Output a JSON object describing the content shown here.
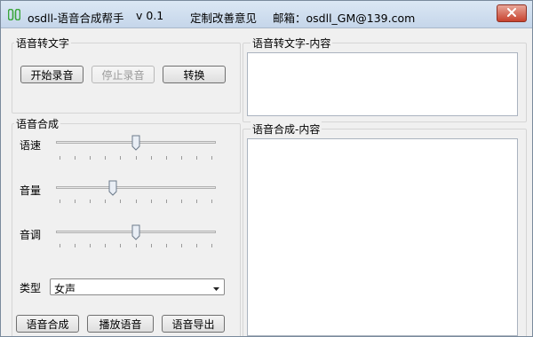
{
  "window": {
    "app_name": "osdll-语音合成帮手",
    "version": "v 0.1",
    "custom_link": "定制改善意见",
    "email": "邮箱：osdll_GM@139.com"
  },
  "stt": {
    "group_label": "语音转文字",
    "start_label": "开始录音",
    "stop_label": "停止录音",
    "convert_label": "转换",
    "content_label": "语音转文字-内容",
    "content_text": ""
  },
  "tts": {
    "group_label": "语音合成",
    "speed_label": "语速",
    "speed_value": 0.5,
    "volume_label": "音量",
    "volume_value": 0.35,
    "pitch_label": "音调",
    "pitch_value": 0.5,
    "type_label": "类型",
    "type_value": "女声",
    "synth_label": "语音合成",
    "play_label": "播放语音",
    "export_label": "语音导出",
    "content_label": "语音合成-内容",
    "content_text": ""
  },
  "colors": {
    "accent": "#c7422e",
    "icon_green": "#3aa53a"
  }
}
